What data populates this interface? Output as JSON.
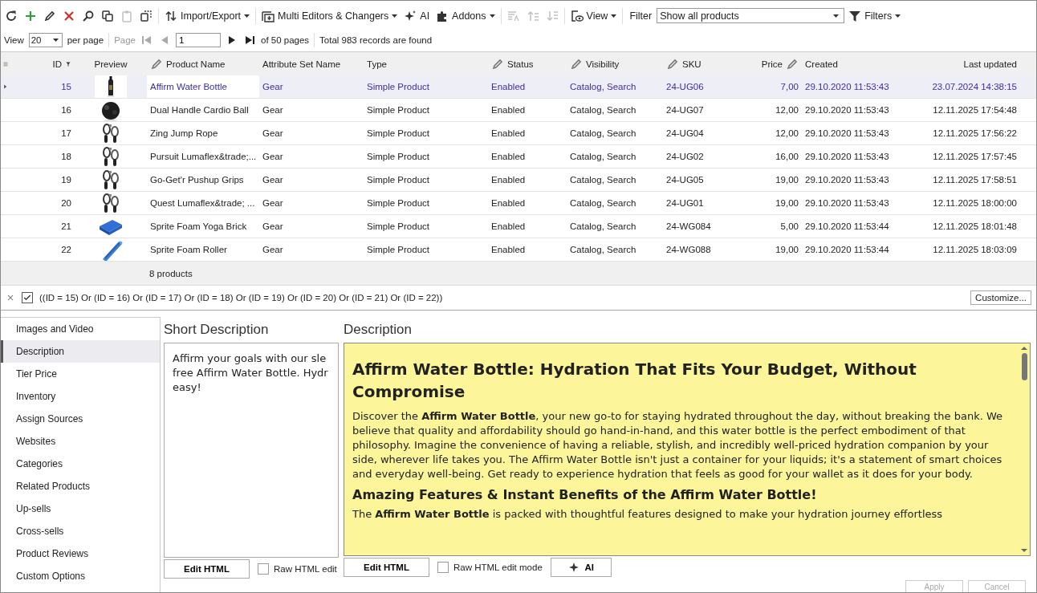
{
  "toolbar": {
    "items": [
      {
        "kind": "icon",
        "disabled": false
      },
      {
        "kind": "icon",
        "disabled": false
      },
      {
        "kind": "icon",
        "disabled": false
      },
      {
        "kind": "icon",
        "disabled": false
      },
      {
        "kind": "icon",
        "disabled": false
      },
      {
        "kind": "icon",
        "disabled": false
      },
      {
        "kind": "icon",
        "disabled": true
      },
      {
        "kind": "icon",
        "disabled": false
      },
      {
        "kind": "menu",
        "label": "Import/Export",
        "disabled": false
      },
      {
        "kind": "menu",
        "label": "Multi Editors & Changers",
        "disabled": false
      },
      {
        "kind": "button",
        "label": "AI",
        "disabled": false
      },
      {
        "kind": "menu",
        "label": "Addons",
        "disabled": false
      },
      {
        "kind": "icon",
        "disabled": true
      },
      {
        "kind": "icon",
        "disabled": true
      },
      {
        "kind": "icon",
        "disabled": true
      },
      {
        "kind": "menu",
        "label": "View",
        "disabled": false
      }
    ],
    "filter_label": "Filter",
    "filter_value": "Show all products",
    "filters_menu": "Filters"
  },
  "pager": {
    "view_label": "View",
    "page_size": "20",
    "per_page": "per page",
    "page_label": "Page",
    "page": "1",
    "of_pages": "of 50 pages",
    "total": "Total 983 records are found"
  },
  "table": {
    "columns": [
      {
        "label": "ID",
        "editable": false,
        "filtered": true
      },
      {
        "label": "Preview",
        "editable": false,
        "filtered": false
      },
      {
        "label": "Product Name",
        "editable": true,
        "filtered": false
      },
      {
        "label": "Attribute Set Name",
        "editable": false,
        "filtered": false
      },
      {
        "label": "Type",
        "editable": false,
        "filtered": false
      },
      {
        "label": "Status",
        "editable": true,
        "filtered": false
      },
      {
        "label": "Visibility",
        "editable": true,
        "filtered": false
      },
      {
        "label": "SKU",
        "editable": true,
        "filtered": false
      },
      {
        "label": "Price",
        "editable": true,
        "filtered": false
      },
      {
        "label": "Created",
        "editable": false,
        "filtered": false
      },
      {
        "label": "Last updated",
        "editable": false,
        "filtered": false
      }
    ],
    "rows": [
      {
        "selected": true,
        "cells": [
          "15",
          "",
          "Affirm Water Bottle",
          "Gear",
          "Simple Product",
          "Enabled",
          "Catalog, Search",
          "24-UG06",
          "7,00",
          "29.10.2020 11:53:43",
          "23.07.2024 14:38:15"
        ]
      },
      {
        "selected": false,
        "cells": [
          "16",
          "",
          "Dual Handle Cardio Ball",
          "Gear",
          "Simple Product",
          "Enabled",
          "Catalog, Search",
          "24-UG07",
          "12,00",
          "29.10.2020 11:53:43",
          "12.11.2025 17:54:48"
        ]
      },
      {
        "selected": false,
        "cells": [
          "17",
          "",
          "Zing Jump Rope",
          "Gear",
          "Simple Product",
          "Enabled",
          "Catalog, Search",
          "24-UG04",
          "12,00",
          "29.10.2020 11:53:43",
          "12.11.2025 17:56:22"
        ]
      },
      {
        "selected": false,
        "cells": [
          "18",
          "",
          "Pursuit Lumaflex&trade;...",
          "Gear",
          "Simple Product",
          "Enabled",
          "Catalog, Search",
          "24-UG02",
          "16,00",
          "29.10.2020 11:53:43",
          "12.11.2025 17:57:45"
        ]
      },
      {
        "selected": false,
        "cells": [
          "19",
          "",
          "Go-Get'r Pushup Grips",
          "Gear",
          "Simple Product",
          "Enabled",
          "Catalog, Search",
          "24-UG05",
          "19,00",
          "29.10.2020 11:53:43",
          "12.11.2025 17:58:51"
        ]
      },
      {
        "selected": false,
        "cells": [
          "20",
          "",
          "Quest Lumaflex&trade; ...",
          "Gear",
          "Simple Product",
          "Enabled",
          "Catalog, Search",
          "24-UG01",
          "19,00",
          "29.10.2020 11:53:43",
          "12.11.2025 18:00:00"
        ]
      },
      {
        "selected": false,
        "cells": [
          "21",
          "",
          "Sprite Foam Yoga Brick",
          "Gear",
          "Simple Product",
          "Enabled",
          "Catalog, Search",
          "24-WG084",
          "5,00",
          "29.10.2020 11:53:44",
          "12.11.2025 18:01:48"
        ]
      },
      {
        "selected": false,
        "cells": [
          "22",
          "",
          "Sprite Foam Roller",
          "Gear",
          "Simple Product",
          "Enabled",
          "Catalog, Search",
          "24-WG088",
          "19,00",
          "29.10.2020 11:53:44",
          "12.11.2025 18:03:09"
        ]
      }
    ],
    "footer": "8 products"
  },
  "filter_bar": {
    "enabled": true,
    "expression": "((ID = 15) Or (ID = 16) Or (ID = 17) Or (ID = 18) Or (ID = 19) Or (ID = 20) Or (ID = 21) Or (ID = 22))",
    "customize": "Customize..."
  },
  "sidebar": {
    "items": [
      {
        "label": "Images and Video",
        "selected": false
      },
      {
        "label": "Description",
        "selected": true
      },
      {
        "label": "Tier Price",
        "selected": false
      },
      {
        "label": "Inventory",
        "selected": false
      },
      {
        "label": "Assign Sources",
        "selected": false
      },
      {
        "label": "Websites",
        "selected": false
      },
      {
        "label": "Categories",
        "selected": false
      },
      {
        "label": "Related Products",
        "selected": false
      },
      {
        "label": "Up-sells",
        "selected": false
      },
      {
        "label": "Cross-sells",
        "selected": false
      },
      {
        "label": "Product Reviews",
        "selected": false
      },
      {
        "label": "Custom Options",
        "selected": false
      }
    ]
  },
  "short_description": {
    "title": "Short Description",
    "lines": [
      "Affirm your goals with our sle",
      "free Affirm Water Bottle. Hydr",
      "easy!"
    ],
    "edit_html": "Edit HTML",
    "raw_mode": {
      "label": "Raw HTML edit",
      "checked": false
    }
  },
  "description": {
    "title": "Description",
    "blocks": [
      {
        "kind": "h1",
        "text": "Affirm Water Bottle: Hydration That Fits Your Budget, Without Compromise"
      },
      {
        "kind": "p",
        "text": "Discover the **Affirm Water Bottle**, your new go-to for staying hydrated throughout the day, without breaking the bank. We believe that quality and affordability should go hand-in-hand, and this water bottle is the perfect embodiment of that philosophy. Imagine the convenience of having a reliable, stylish, and incredibly well-priced hydration companion by your side, wherever life takes you. The Affirm Water Bottle isn't just a container for your liquids; it's a statement of smart choices and everyday well-being. Get ready to experience hydration that feels as good for your wallet as it does for your body."
      },
      {
        "kind": "h2",
        "text": "Amazing Features & Instant Benefits of the Affirm Water Bottle!"
      },
      {
        "kind": "p",
        "text": "The **Affirm Water Bottle** is packed with thoughtful features designed to make your hydration journey effortless"
      }
    ],
    "edit_html": "Edit HTML",
    "raw_mode": {
      "label": "Raw HTML edit mode",
      "checked": false
    },
    "ai": "AI"
  },
  "actions": [
    {
      "label": "Apply",
      "disabled": true
    },
    {
      "label": "Cancel",
      "disabled": true
    }
  ]
}
